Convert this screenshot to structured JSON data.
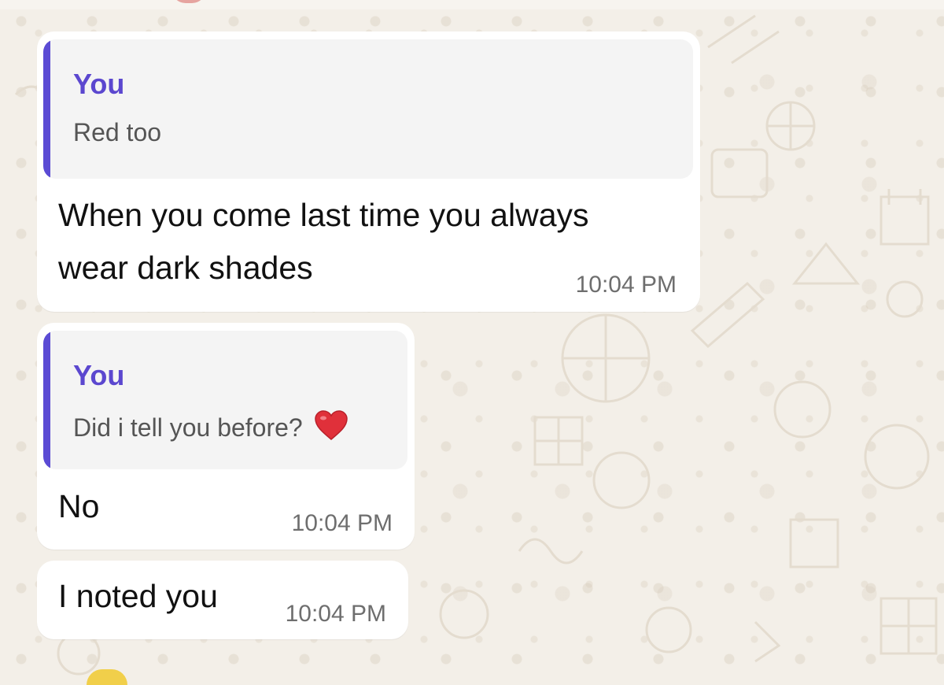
{
  "messages": [
    {
      "quote": {
        "author": "You",
        "text": "Red too"
      },
      "text_lines": [
        "When you come last time you always",
        "wear dark shades"
      ],
      "time": "10:04 PM"
    },
    {
      "quote": {
        "author": "You",
        "text": "Did i tell you before?",
        "emoji": "heart-icon"
      },
      "text": "No",
      "time": "10:04 PM"
    },
    {
      "text": "I noted you",
      "time": "10:04 PM"
    }
  ],
  "colors": {
    "background": "#f3efe8",
    "bubble": "#ffffff",
    "quote_background": "#f4f4f4",
    "quote_accent": "#5b4bd4",
    "quote_author": "#5b47cf",
    "heart": "#e0303a"
  }
}
